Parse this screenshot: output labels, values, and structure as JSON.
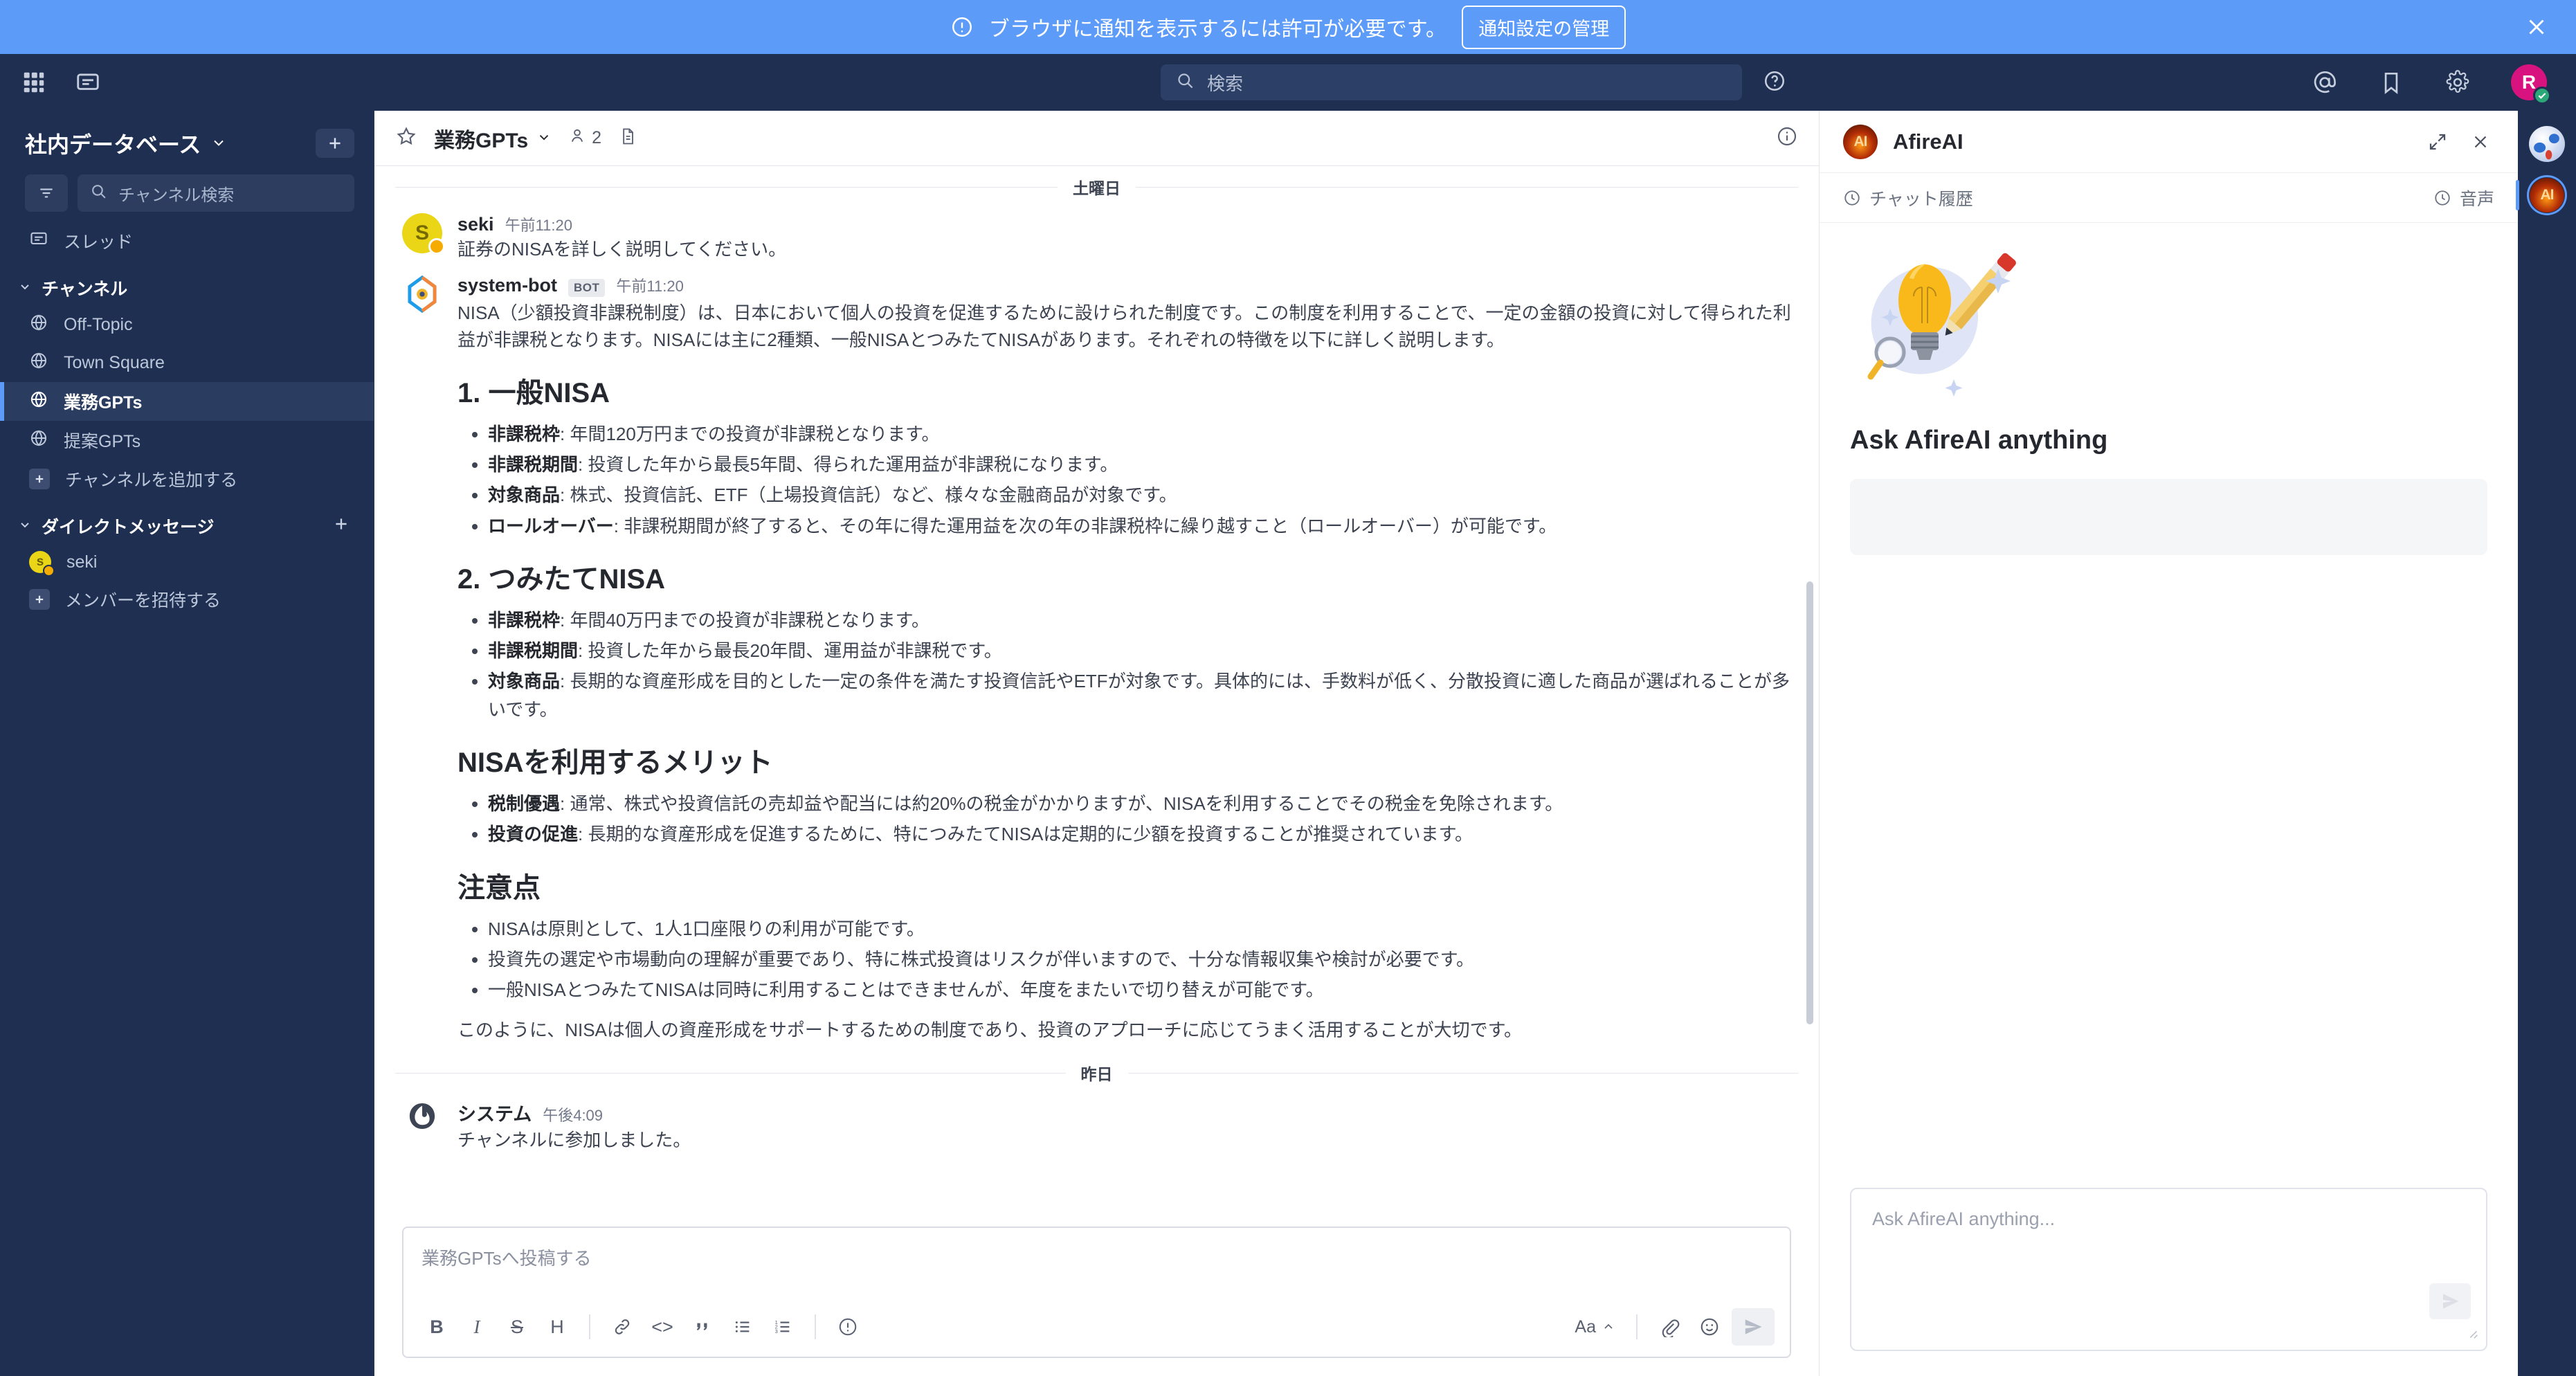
{
  "notification": {
    "icon": "info-circle-icon",
    "text": "ブラウザに通知を表示するには許可が必要です。",
    "button_label": "通知設定の管理",
    "close_icon": "close-icon",
    "bg_color": "#5d9bf9"
  },
  "global_header": {
    "grid_icon": "apps-grid-icon",
    "messages_icon": "chat-bubble-icon",
    "search": {
      "placeholder": "検索",
      "icon": "search-icon"
    },
    "help_icon": "help-circle-icon",
    "mentions_icon": "at-mention-icon",
    "saved_icon": "bookmark-icon",
    "settings_icon": "gear-icon",
    "avatar": {
      "initial": "R",
      "bg_color": "#d8127f",
      "status": "online",
      "status_color": "#2aa877"
    }
  },
  "sidebar": {
    "team_name": "社内データベース",
    "team_chevron_icon": "chevron-down-icon",
    "add_button_icon": "plus-icon",
    "filter_icon": "filter-icon",
    "channel_search_placeholder": "チャンネル検索",
    "threads": {
      "label": "スレッド",
      "icon": "thread-icon"
    },
    "channels_section": {
      "label": "チャンネル",
      "chevron_icon": "chevron-down-icon",
      "items": [
        {
          "label": "Off-Topic",
          "icon": "globe-icon",
          "active": false
        },
        {
          "label": "Town Square",
          "icon": "globe-icon",
          "active": false
        },
        {
          "label": "業務GPTs",
          "icon": "globe-icon",
          "active": true
        },
        {
          "label": "提案GPTs",
          "icon": "globe-icon",
          "active": false
        }
      ],
      "add_channel_label": "チャンネルを追加する",
      "add_channel_icon": "plus-square-icon"
    },
    "dm_section": {
      "label": "ダイレクトメッセージ",
      "chevron_icon": "chevron-down-icon",
      "add_icon": "plus-icon",
      "items": [
        {
          "label": "seki",
          "avatar_initial": "s",
          "avatar_color": "#ead617",
          "status": "away"
        }
      ],
      "invite_label": "メンバーを招待する",
      "invite_icon": "plus-square-icon"
    }
  },
  "channel_header": {
    "favorite_icon": "star-icon",
    "title": "業務GPTs",
    "chevron_icon": "chevron-down-icon",
    "member_icon": "person-icon",
    "member_count": "2",
    "files_icon": "file-icon",
    "info_icon": "info-circle-icon"
  },
  "messages": {
    "date_separator_1": "土曜日",
    "date_separator_2": "昨日",
    "items": [
      {
        "user": "seki",
        "time": "午前11:20",
        "avatar_initial": "S",
        "avatar_color": "#ead617",
        "text": "証券のNISAを詳しく説明してください。"
      },
      {
        "user": "system-bot",
        "bot_tag": "BOT",
        "time": "午前11:20",
        "avatar_type": "mattermost-bot-logo",
        "intro": "NISA（少額投資非課税制度）は、日本において個人の投資を促進するために設けられた制度です。この制度を利用することで、一定の金額の投資に対して得られた利益が非課税となります。NISAには主に2種類、一般NISAとつみたてNISAがあります。それぞれの特徴を以下に詳しく説明します。",
        "sections": [
          {
            "heading": "1. 一般NISA",
            "bullets": [
              {
                "term": "非課税枠",
                "desc": ": 年間120万円までの投資が非課税となります。"
              },
              {
                "term": "非課税期間",
                "desc": ": 投資した年から最長5年間、得られた運用益が非課税になります。"
              },
              {
                "term": "対象商品",
                "desc": ": 株式、投資信託、ETF（上場投資信託）など、様々な金融商品が対象です。"
              },
              {
                "term": "ロールオーバー",
                "desc": ": 非課税期間が終了すると、その年に得た運用益を次の年の非課税枠に繰り越すこと（ロールオーバー）が可能です。"
              }
            ]
          },
          {
            "heading": "2. つみたてNISA",
            "bullets": [
              {
                "term": "非課税枠",
                "desc": ": 年間40万円までの投資が非課税となります。"
              },
              {
                "term": "非課税期間",
                "desc": ": 投資した年から最長20年間、運用益が非課税です。"
              },
              {
                "term": "対象商品",
                "desc": ": 長期的な資産形成を目的とした一定の条件を満たす投資信託やETFが対象です。具体的には、手数料が低く、分散投資に適した商品が選ばれることが多いです。"
              }
            ]
          },
          {
            "heading": "NISAを利用するメリット",
            "bullets": [
              {
                "term": "税制優遇",
                "desc": ": 通常、株式や投資信託の売却益や配当には約20%の税金がかかりますが、NISAを利用することでその税金を免除されます。"
              },
              {
                "term": "投資の促進",
                "desc": ": 長期的な資産形成を促進するために、特につみたてNISAは定期的に少額を投資することが推奨されています。"
              }
            ]
          },
          {
            "heading": "注意点",
            "bullets": [
              {
                "term": "",
                "desc": "NISAは原則として、1人1口座限りの利用が可能です。"
              },
              {
                "term": "",
                "desc": "投資先の選定や市場動向の理解が重要であり、特に株式投資はリスクが伴いますので、十分な情報収集や検討が必要です。"
              },
              {
                "term": "",
                "desc": "一般NISAとつみたてNISAは同時に利用することはできませんが、年度をまたいで切り替えが可能です。"
              }
            ]
          }
        ],
        "closing": "このように、NISAは個人の資産形成をサポートするための制度であり、投資のアプローチに応じてうまく活用することが大切です。"
      },
      {
        "user": "システム",
        "time": "午後4:09",
        "avatar_type": "mattermost-logo",
        "text": "チャンネルに参加しました。"
      }
    ]
  },
  "composer": {
    "placeholder": "業務GPTsへ投稿する",
    "toolbar": [
      {
        "name": "bold",
        "glyph": "B"
      },
      {
        "name": "italic",
        "glyph": "I"
      },
      {
        "name": "strikethrough",
        "glyph": "S"
      },
      {
        "name": "heading",
        "glyph": "H"
      },
      {
        "name": "link",
        "glyph": "link-icon"
      },
      {
        "name": "code",
        "glyph": "<>"
      },
      {
        "name": "quote",
        "glyph": "quote-icon"
      },
      {
        "name": "bulleted-list",
        "glyph": "bullet-list-icon"
      },
      {
        "name": "numbered-list",
        "glyph": "numbered-list-icon"
      },
      {
        "name": "info",
        "glyph": "info-circle-icon"
      }
    ],
    "format_toggle_label": "Aa",
    "attach_icon": "paperclip-icon",
    "emoji_icon": "emoji-icon",
    "send_icon": "send-icon"
  },
  "ai_panel": {
    "logo": "afireai-logo",
    "title": "AfireAI",
    "expand_icon": "expand-icon",
    "close_icon": "close-icon",
    "history_chip": {
      "label": "チャット履歴",
      "icon": "clock-icon"
    },
    "voice_chip": {
      "label": "音声",
      "icon": "clock-icon"
    },
    "illustration": "lightbulb-pencil-magnifier-illustration",
    "ask_title": "Ask AfireAI anything",
    "input_placeholder": "Ask AfireAI anything...",
    "send_icon": "send-icon"
  },
  "app_rail": {
    "items": [
      {
        "name": "globe-app",
        "selected": false
      },
      {
        "name": "afireai-app",
        "selected": true
      }
    ]
  }
}
